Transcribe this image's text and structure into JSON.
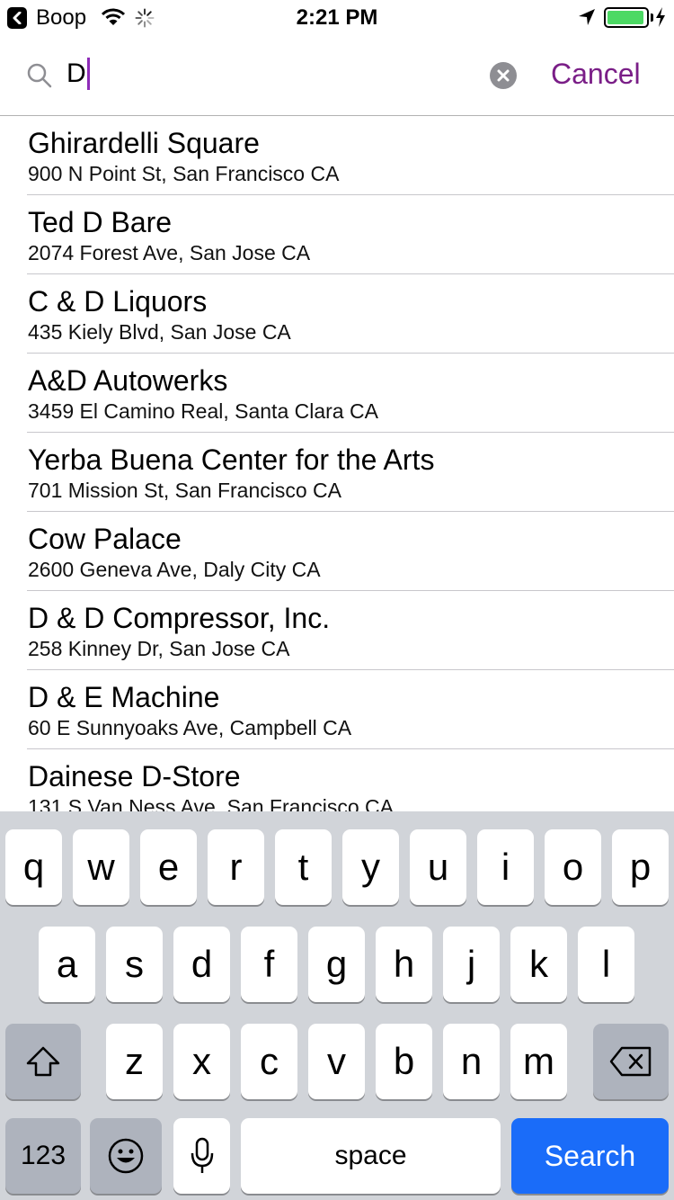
{
  "status_bar": {
    "back_app": "Boop",
    "time": "2:21 PM",
    "battery_level": 0.95,
    "colors": {
      "battery": "#4cd964"
    }
  },
  "search": {
    "query": "D",
    "cancel_label": "Cancel",
    "accent_color": "#7a1e87"
  },
  "results": [
    {
      "name": "Ghirardelli Square",
      "address": "900 N Point St, San Francisco CA"
    },
    {
      "name": "Ted D Bare",
      "address": "2074 Forest Ave, San Jose CA"
    },
    {
      "name": "C & D Liquors",
      "address": "435 Kiely Blvd, San Jose CA"
    },
    {
      "name": "A&D Autowerks",
      "address": "3459 El Camino Real, Santa Clara CA"
    },
    {
      "name": "Yerba Buena Center for the Arts",
      "address": "701 Mission St, San Francisco CA"
    },
    {
      "name": "Cow Palace",
      "address": "2600 Geneva Ave, Daly City CA"
    },
    {
      "name": "D & D Compressor, Inc.",
      "address": "258 Kinney Dr, San Jose CA"
    },
    {
      "name": "D & E Machine",
      "address": "60 E Sunnyoaks Ave, Campbell CA"
    },
    {
      "name": "Dainese D-Store",
      "address": "131 S Van Ness Ave, San Francisco CA"
    }
  ],
  "keyboard": {
    "row1": [
      "q",
      "w",
      "e",
      "r",
      "t",
      "y",
      "u",
      "i",
      "o",
      "p"
    ],
    "row2": [
      "a",
      "s",
      "d",
      "f",
      "g",
      "h",
      "j",
      "k",
      "l"
    ],
    "row3": [
      "z",
      "x",
      "c",
      "v",
      "b",
      "n",
      "m"
    ],
    "numbers_label": "123",
    "space_label": "space",
    "search_label": "Search",
    "icons": {
      "shift": "shift-icon",
      "delete": "delete-icon",
      "emoji": "emoji-icon",
      "mic": "microphone-icon"
    }
  }
}
